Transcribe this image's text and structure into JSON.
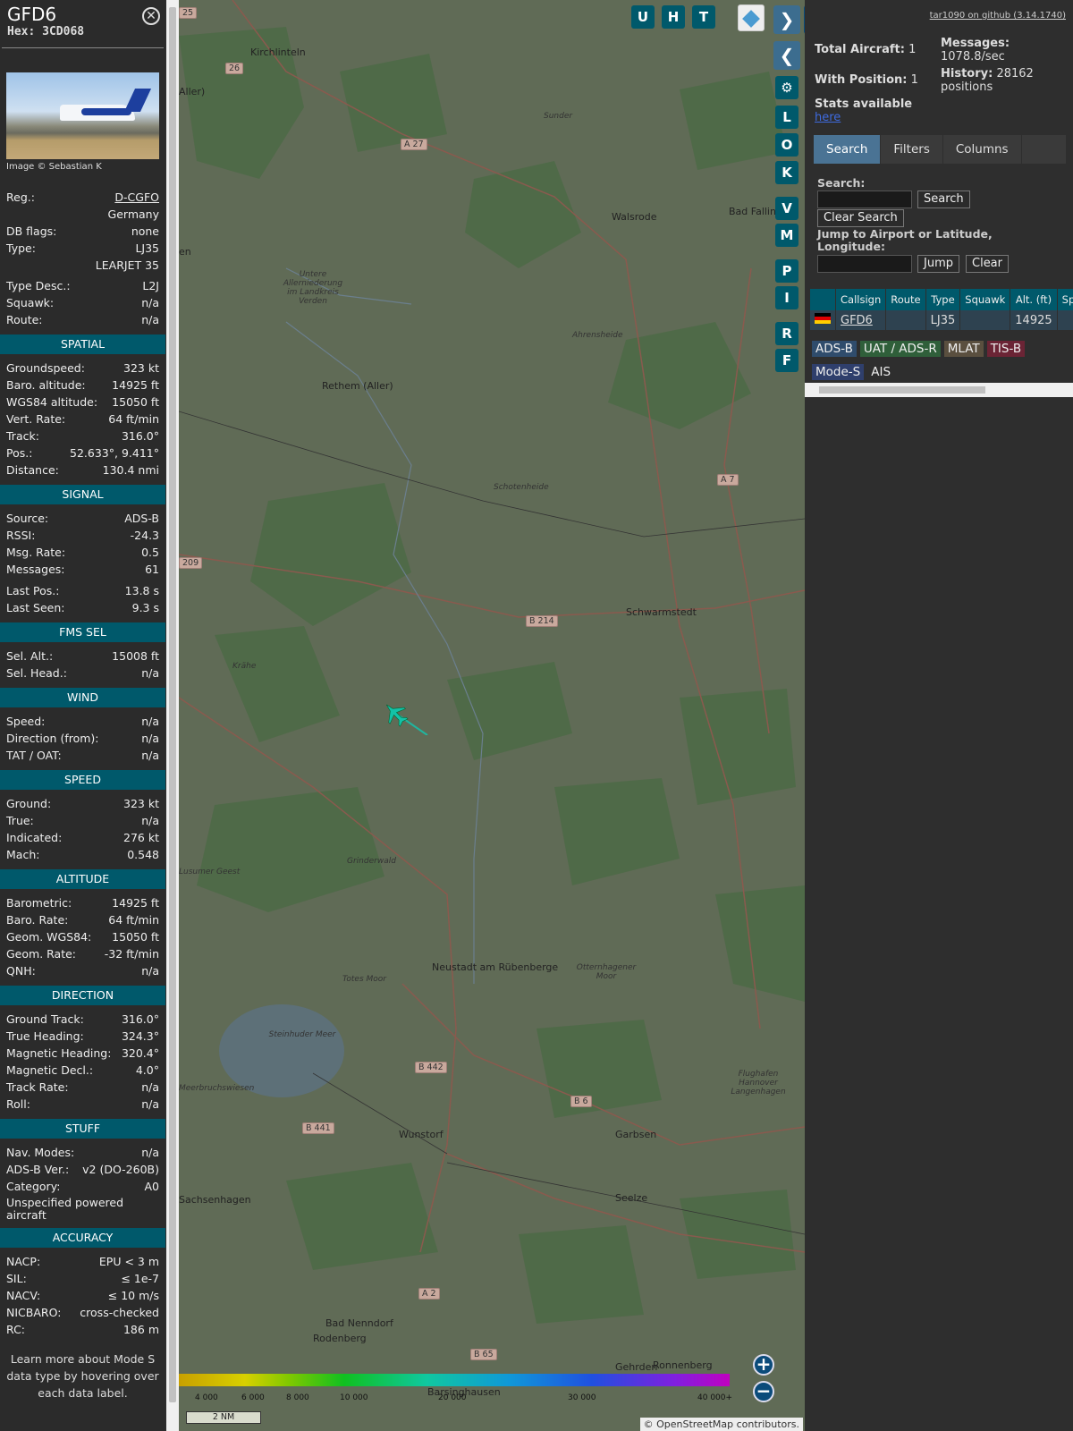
{
  "info": {
    "callsign": "GFD6",
    "hex_label": "Hex:",
    "hex": "3CD068",
    "photo_credit": "Image © Sebastian K",
    "basic": [
      {
        "k": "Reg.:",
        "v": "D-CGFO",
        "link": true
      },
      {
        "k": "",
        "v": "Germany"
      },
      {
        "k": "DB flags:",
        "v": "none"
      },
      {
        "k": "Type:",
        "v": "LJ35"
      },
      {
        "k": "",
        "v": "LEARJET 35"
      },
      {
        "k": "Type Desc.:",
        "v": "L2J"
      },
      {
        "k": "Squawk:",
        "v": "n/a"
      },
      {
        "k": "Route:",
        "v": "n/a"
      }
    ],
    "sections": [
      {
        "title": "SPATIAL",
        "rows": [
          [
            "Groundspeed:",
            "323 kt"
          ],
          [
            "Baro. altitude:",
            "14925 ft"
          ],
          [
            "WGS84 altitude:",
            "15050 ft"
          ],
          [
            "Vert. Rate:",
            "64 ft/min"
          ],
          [
            "Track:",
            "316.0°"
          ],
          [
            "Pos.:",
            "52.633°, 9.411°"
          ],
          [
            "Distance:",
            "130.4 nmi"
          ]
        ]
      },
      {
        "title": "SIGNAL",
        "rows": [
          [
            "Source:",
            "ADS-B"
          ],
          [
            "RSSI:",
            "-24.3"
          ],
          [
            "Msg. Rate:",
            "0.5"
          ],
          [
            "Messages:",
            "61"
          ],
          [
            "Last Pos.:",
            "13.8 s"
          ],
          [
            "Last Seen:",
            "9.3 s"
          ]
        ]
      },
      {
        "title": "FMS SEL",
        "rows": [
          [
            "Sel. Alt.:",
            "15008 ft"
          ],
          [
            "Sel. Head.:",
            "n/a"
          ]
        ]
      },
      {
        "title": "WIND",
        "rows": [
          [
            "Speed:",
            "n/a"
          ],
          [
            "Direction (from):",
            "n/a"
          ],
          [
            "TAT / OAT:",
            "n/a"
          ]
        ]
      },
      {
        "title": "SPEED",
        "rows": [
          [
            "Ground:",
            "323 kt"
          ],
          [
            "True:",
            "n/a"
          ],
          [
            "Indicated:",
            "276 kt"
          ],
          [
            "Mach:",
            "0.548"
          ]
        ]
      },
      {
        "title": "ALTITUDE",
        "rows": [
          [
            "Barometric:",
            "14925 ft"
          ],
          [
            "Baro. Rate:",
            "64 ft/min"
          ],
          [
            "Geom. WGS84:",
            "15050 ft"
          ],
          [
            "Geom. Rate:",
            "-32 ft/min"
          ],
          [
            "QNH:",
            "n/a"
          ]
        ]
      },
      {
        "title": "DIRECTION",
        "rows": [
          [
            "Ground Track:",
            "316.0°"
          ],
          [
            "True Heading:",
            "324.3°"
          ],
          [
            "Magnetic Heading:",
            "320.4°"
          ],
          [
            "Magnetic Decl.:",
            "4.0°"
          ],
          [
            "Track Rate:",
            "n/a"
          ],
          [
            "Roll:",
            "n/a"
          ]
        ]
      },
      {
        "title": "STUFF",
        "rows": [
          [
            "Nav. Modes:",
            "n/a"
          ],
          [
            "ADS-B Ver.:",
            "v2 (DO-260B)"
          ],
          [
            "Category:",
            "A0"
          ]
        ],
        "extra": "Unspecified powered aircraft"
      },
      {
        "title": "ACCURACY",
        "rows": [
          [
            "NACP:",
            "EPU < 3 m"
          ],
          [
            "SIL:",
            "≤ 1e-7"
          ],
          [
            "NACV:",
            "≤ 10 m/s"
          ],
          [
            "NICBARO:",
            "cross-checked"
          ],
          [
            "RC:",
            "186 m"
          ]
        ]
      }
    ],
    "note": "Learn more about Mode S data type by hovering over each data label."
  },
  "map": {
    "towns": [
      {
        "t": "Kirchlinteln",
        "c": ""
      },
      {
        "t": "Sunder",
        "c": "it"
      },
      {
        "t": "Walsrode",
        "c": ""
      },
      {
        "t": "Bad Falling",
        "c": ""
      },
      {
        "t": "Untere Allerniederung im Landkreis Verden",
        "c": "it"
      },
      {
        "t": "Ahrensheide",
        "c": "it"
      },
      {
        "t": "Rethem (Aller)",
        "c": ""
      },
      {
        "t": "Schotenheide",
        "c": "it"
      },
      {
        "t": "Schwarmstedt",
        "c": ""
      },
      {
        "t": "Krähe",
        "c": "it"
      },
      {
        "t": "Grinderwald",
        "c": "it"
      },
      {
        "t": "Neustadt am Rübenberge",
        "c": ""
      },
      {
        "t": "Totes Moor",
        "c": "it"
      },
      {
        "t": "Otternhagener Moor",
        "c": "it"
      },
      {
        "t": "Steinhuder Meer",
        "c": "it"
      },
      {
        "t": "Meerbruchswiesen",
        "c": "it"
      },
      {
        "t": "Flughafen Hannover Langenhagen",
        "c": "it"
      },
      {
        "t": "Wunstorf",
        "c": ""
      },
      {
        "t": "Garbsen",
        "c": ""
      },
      {
        "t": "Seelze",
        "c": ""
      },
      {
        "t": "Sachsenhagen",
        "c": ""
      },
      {
        "t": "Bad Nenndorf",
        "c": ""
      },
      {
        "t": "Rodenberg",
        "c": ""
      },
      {
        "t": "Gehrden",
        "c": ""
      },
      {
        "t": "Ronnenberg",
        "c": ""
      },
      {
        "t": "Barsinghausen",
        "c": ""
      },
      {
        "t": "Lusumer Geest",
        "c": "it"
      },
      {
        "t": "Aller)",
        "c": ""
      },
      {
        "t": "en",
        "c": ""
      }
    ],
    "roads": [
      "A 27",
      "A 7",
      "B 214",
      "B 442",
      "B 441",
      "B 6",
      "A 2",
      "B 65",
      "209",
      "26",
      "25"
    ],
    "buttons_top": [
      "U",
      "H",
      "T"
    ],
    "buttons_side": [
      "L",
      "O",
      "K",
      "V",
      "M",
      "P",
      "I",
      "R",
      "F"
    ],
    "alt_ticks": [
      "4 000",
      "6 000",
      "8 000",
      "10 000",
      "20 000",
      "30 000",
      "40 000+"
    ],
    "scale": "2 NM",
    "attribution": "© OpenStreetMap contributors."
  },
  "panel": {
    "github": "tar1090 on github (3.14.1740)",
    "total_label": "Total Aircraft:",
    "total": "1",
    "withpos_label": "With Position:",
    "withpos": "1",
    "messages_label": "Messages:",
    "messages": "1078.8/sec",
    "history_label": "History:",
    "history": "28162 positions",
    "stats_label": "Stats available",
    "stats_link": "here",
    "tabs": [
      "Search",
      "Filters",
      "Columns"
    ],
    "search_label": "Search:",
    "search_btn": "Search",
    "clear_search_btn": "Clear Search",
    "jump_label": "Jump to Airport or Latitude, Longitude:",
    "jump_btn": "Jump",
    "clear_btn": "Clear",
    "table": {
      "headers": [
        "",
        "Callsign",
        "Route",
        "Type",
        "Squawk",
        "Alt. (ft)",
        "Spd."
      ],
      "rows": [
        [
          "",
          "GFD6",
          "",
          "LJ35",
          "",
          "14925",
          ""
        ]
      ]
    },
    "sources": [
      {
        "t": "ADS-B",
        "c": "#2f4c6c"
      },
      {
        "t": "UAT / ADS-R",
        "c": "#2f5f3a"
      },
      {
        "t": "MLAT",
        "c": "#5a4f3f"
      },
      {
        "t": "TIS-B",
        "c": "#6b2435"
      },
      {
        "t": "Mode-S",
        "c": "#2f3f6c"
      },
      {
        "t": "AIS",
        "c": "#2e2e2e"
      }
    ]
  }
}
